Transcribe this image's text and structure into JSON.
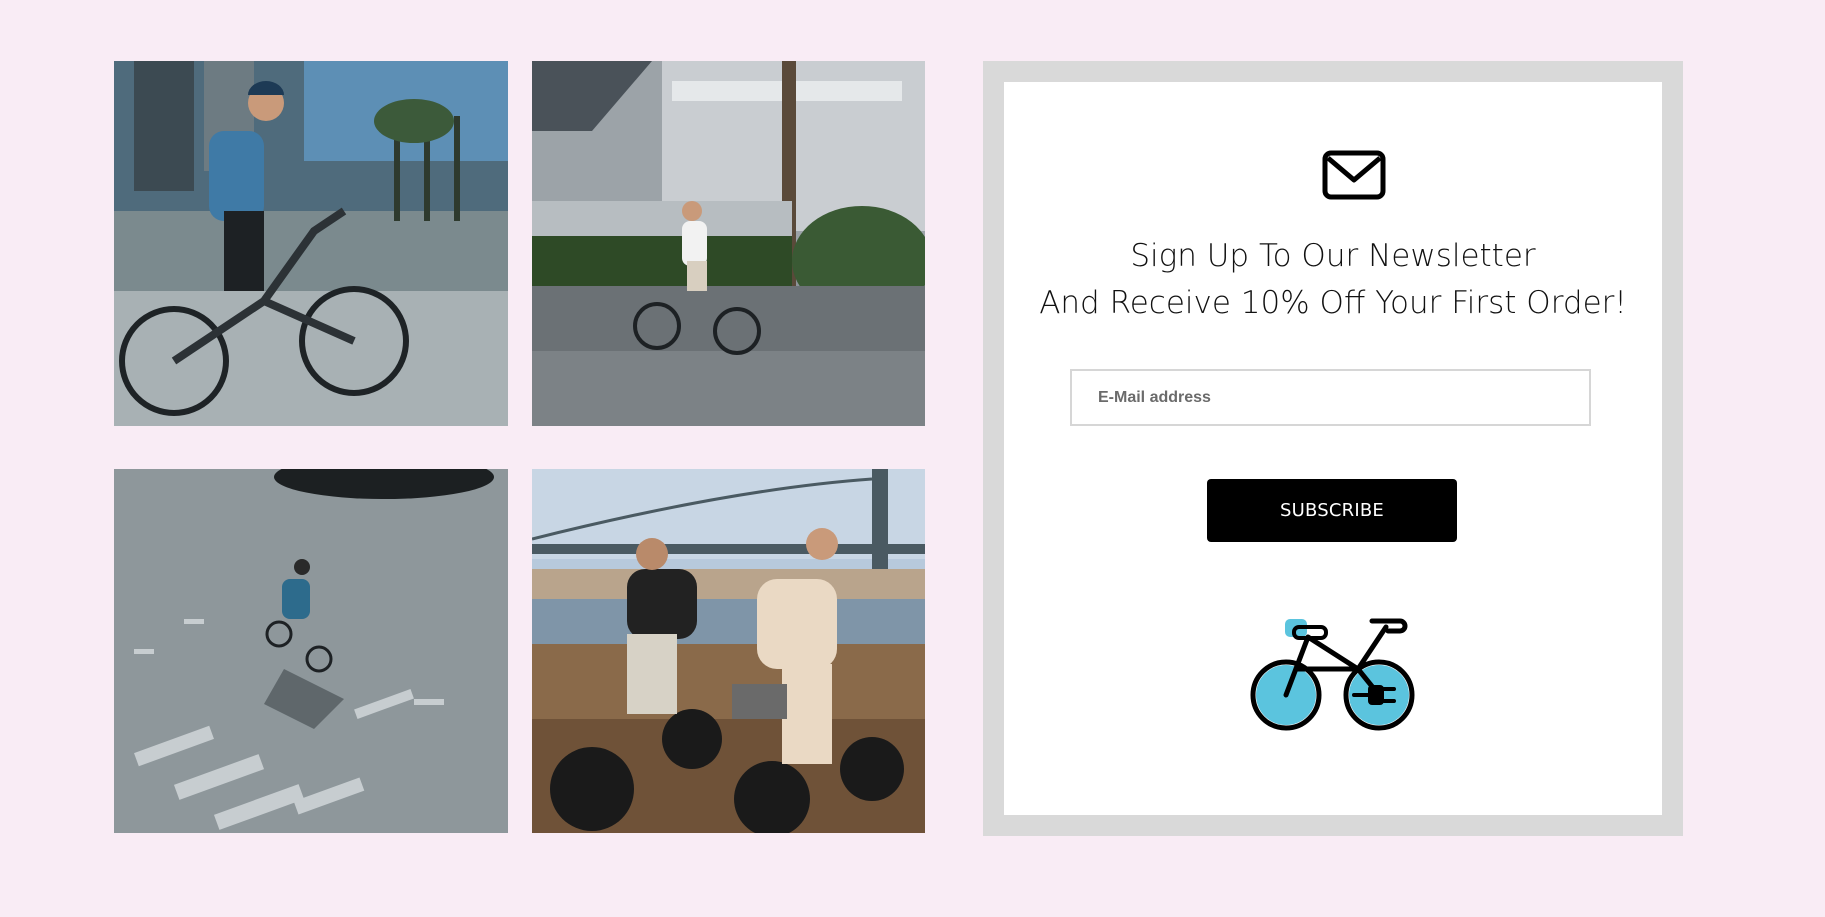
{
  "gallery": {
    "photos": [
      {
        "alt": "Man in denim jacket riding an e-bike in the city"
      },
      {
        "alt": "Rider in white shirt on an e-bike in front of a house"
      },
      {
        "alt": "Aerial view of cyclist crossing a street"
      },
      {
        "alt": "Two riders on fat-tire e-bikes near a bridge"
      }
    ]
  },
  "newsletter": {
    "headline_line1": "Sign Up To Our Newsletter",
    "headline_line2": "And Receive 10% Off Your First Order!",
    "email_placeholder": "E-Mail address",
    "subscribe_label": "SUBSCRIBE",
    "icon": "envelope-icon",
    "brand_icon": "electric-bike-icon",
    "colors": {
      "page_bg": "#f9ecf5",
      "panel_border": "#d9d9d9",
      "button_bg": "#000000",
      "bike_accent": "#5bc4de"
    }
  }
}
